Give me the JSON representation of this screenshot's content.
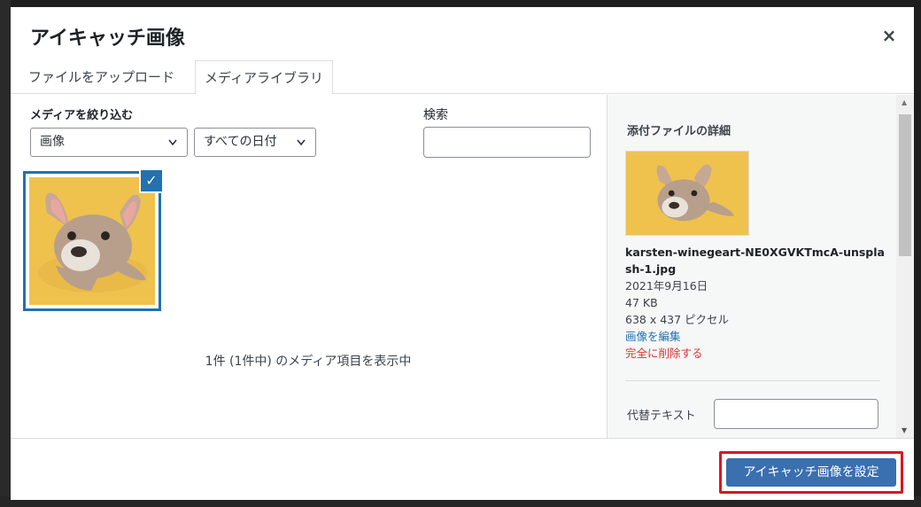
{
  "modal": {
    "title": "アイキャッチ画像",
    "close_glyph": "×"
  },
  "tabs": [
    {
      "label": "ファイルをアップロード"
    },
    {
      "label": "メディアライブラリ"
    }
  ],
  "filters": {
    "label": "メディアを絞り込む",
    "type_value": "画像",
    "date_value": "すべての日付",
    "search_label": "検索",
    "search_value": ""
  },
  "grid": {
    "check_glyph": "✓",
    "count_text": "1件 (1件中) のメディア項目を表示中"
  },
  "details": {
    "title": "添付ファイルの詳細",
    "filename": "karsten-winegeart-NE0XGVKTmcA-unsplash-1.jpg",
    "date": "2021年9月16日",
    "size": "47 KB",
    "dimensions": "638 x 437 ピクセル",
    "edit_link": "画像を編集",
    "delete_link": "完全に削除する",
    "alt_label": "代替テキスト",
    "alt_value": ""
  },
  "footer": {
    "set_button": "アイキャッチ画像を設定"
  },
  "colors": {
    "accent": "#2271b1",
    "danger": "#d63638",
    "highlight_border": "#e0141e",
    "thumb_bg": "#efc24e"
  }
}
